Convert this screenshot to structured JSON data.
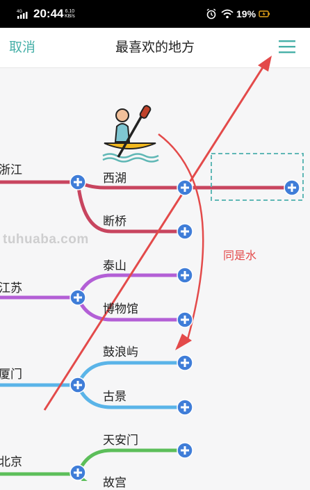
{
  "status_bar": {
    "network": "4G",
    "time": "20:44",
    "net_speed": "6.10",
    "net_speed_unit": "KB/s",
    "battery": "19%"
  },
  "header": {
    "cancel": "取消",
    "title": "最喜欢的地方",
    "menu_icon": "hamburger-menu-icon"
  },
  "mindmap": {
    "branches": [
      {
        "name": "浙江",
        "color": "#c8455f",
        "children": [
          "西湖",
          "断桥"
        ]
      },
      {
        "name": "江苏",
        "color": "#b35fd6",
        "children": [
          "泰山",
          "博物馆"
        ]
      },
      {
        "name": "厦门",
        "color": "#5ab4e8",
        "children": [
          "鼓浪屿",
          "古景"
        ]
      },
      {
        "name": "北京",
        "color": "#5cbe5a",
        "children": [
          "天安门",
          "故宫"
        ]
      }
    ],
    "sticker_icon": "kayak-icon",
    "add_icon": "add-node-icon"
  },
  "annotation": {
    "text": "同是水",
    "color": "#e34a4a"
  },
  "watermark": "tuhuaba.com"
}
